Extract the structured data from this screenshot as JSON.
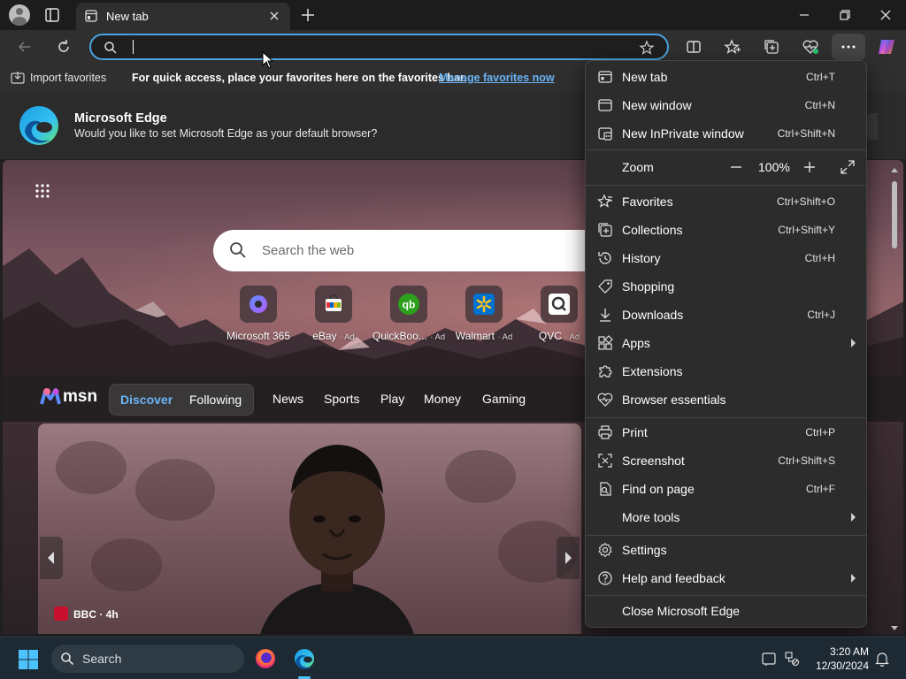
{
  "browser": {
    "tab": {
      "title": "New tab"
    },
    "address_bar": {
      "value": ""
    }
  },
  "favorites_bar": {
    "import_label": "Import favorites",
    "message": "For quick access, place your favorites here on the favorites bar.",
    "manage_link": "Manage favorites now"
  },
  "banner": {
    "title": "Microsoft Edge",
    "text": "Would you like to set Microsoft Edge as your default browser?"
  },
  "ntp": {
    "search_placeholder": "Search the web",
    "quick_links": [
      {
        "label": "Microsoft 365",
        "ad": ""
      },
      {
        "label": "eBay",
        "ad": "· Ad"
      },
      {
        "label": "QuickBoo...",
        "ad": "· Ad"
      },
      {
        "label": "Walmart",
        "ad": "· Ad"
      },
      {
        "label": "QVC",
        "ad": "· Ad"
      }
    ],
    "feed": {
      "brand": "msn",
      "pill": {
        "active": "Discover",
        "other": "Following"
      },
      "tabs": [
        "News",
        "Sports",
        "Play",
        "Money",
        "Gaming"
      ]
    },
    "card": {
      "source": "BBC · 4h"
    }
  },
  "menu": {
    "items": [
      {
        "label": "New tab",
        "shortcut": "Ctrl+T"
      },
      {
        "label": "New window",
        "shortcut": "Ctrl+N"
      },
      {
        "label": "New InPrivate window",
        "shortcut": "Ctrl+Shift+N"
      },
      {
        "label": "Zoom",
        "shortcut": ""
      },
      {
        "label": "Favorites",
        "shortcut": "Ctrl+Shift+O"
      },
      {
        "label": "Collections",
        "shortcut": "Ctrl+Shift+Y"
      },
      {
        "label": "History",
        "shortcut": "Ctrl+H"
      },
      {
        "label": "Shopping",
        "shortcut": ""
      },
      {
        "label": "Downloads",
        "shortcut": "Ctrl+J"
      },
      {
        "label": "Apps",
        "shortcut": ""
      },
      {
        "label": "Extensions",
        "shortcut": ""
      },
      {
        "label": "Browser essentials",
        "shortcut": ""
      },
      {
        "label": "Print",
        "shortcut": "Ctrl+P"
      },
      {
        "label": "Screenshot",
        "shortcut": "Ctrl+Shift+S"
      },
      {
        "label": "Find on page",
        "shortcut": "Ctrl+F"
      },
      {
        "label": "More tools",
        "shortcut": ""
      },
      {
        "label": "Settings",
        "shortcut": ""
      },
      {
        "label": "Help and feedback",
        "shortcut": ""
      },
      {
        "label": "Close Microsoft Edge",
        "shortcut": ""
      }
    ],
    "zoom_value": "100%"
  },
  "taskbar": {
    "search_label": "Search",
    "time": "3:20 AM",
    "date": "12/30/2024"
  },
  "colors": {
    "accent": "#4aa3df",
    "link": "#6ab4f5",
    "menu_bg": "#2c2c2c",
    "taskbar_bg": "#1e2a33"
  }
}
